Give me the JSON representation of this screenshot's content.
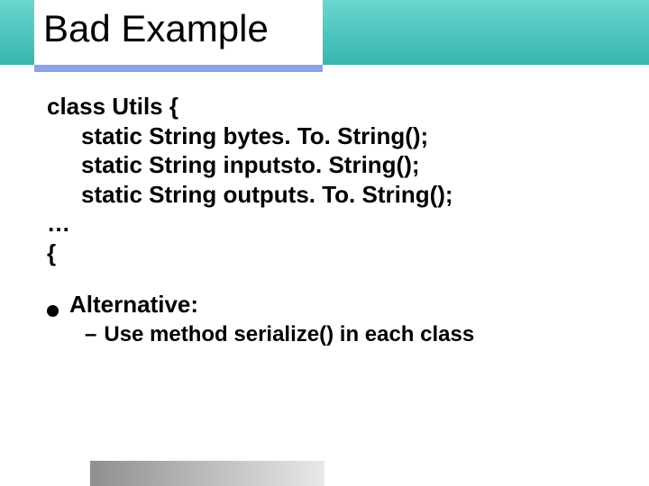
{
  "title": "Bad Example",
  "code": {
    "line1": "class Utils {",
    "line2": "static String bytes. To. String();",
    "line3": "static String inputsto. String();",
    "line4": "static String outputs. To. String();",
    "line5": "…",
    "line6": "{"
  },
  "bullet": {
    "label": "Alternative:",
    "sub": "Use method serialize() in each class"
  }
}
